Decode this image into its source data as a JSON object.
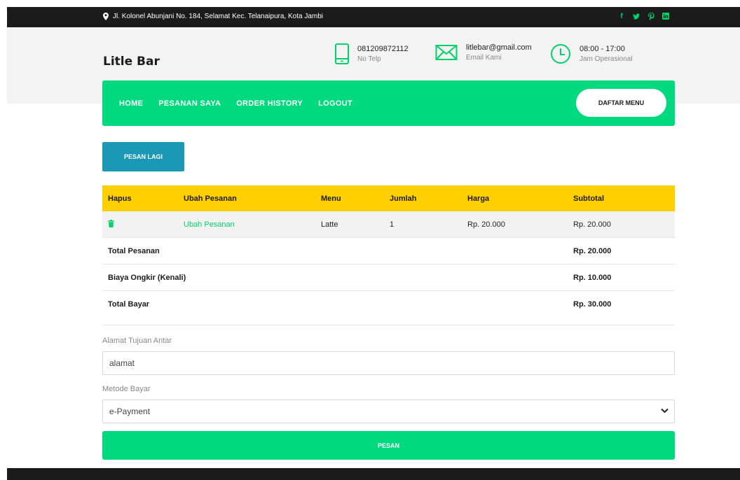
{
  "topbar": {
    "address": "Jl. Kolonel Abunjani No. 184, Selamat Kec. Telanaipura, Kota Jambi",
    "social": [
      "facebook-icon",
      "twitter-icon",
      "pinterest-icon",
      "linkedin-icon"
    ]
  },
  "header": {
    "brand": "Litle Bar",
    "phone": {
      "value": "081209872112",
      "label": "No Telp"
    },
    "email": {
      "value": "litlebar@gmail.com",
      "label": "Email Kami"
    },
    "hours": {
      "value": "08:00 - 17:00",
      "label": "Jam Operasional"
    }
  },
  "nav": {
    "items": [
      "HOME",
      "PESANAN SAYA",
      "ORDER HISTORY",
      "LOGOUT"
    ],
    "cta": "DAFTAR MENU"
  },
  "actions": {
    "pesan_lagi": "PESAN LAGI",
    "pesan": "PESAN"
  },
  "table": {
    "headers": [
      "Hapus",
      "Ubah Pesanan",
      "Menu",
      "Jumlah",
      "Harga",
      "Subtotal"
    ],
    "rows": [
      {
        "ubah": "Ubah Pesanan",
        "menu": "Latte",
        "jumlah": "1",
        "harga": "Rp. 20.000",
        "subtotal": "Rp. 20.000"
      }
    ],
    "summary": [
      {
        "label": "Total Pesanan",
        "value": "Rp. 20.000"
      },
      {
        "label": "Biaya Ongkir (Kenali)",
        "value": "Rp. 10.000"
      },
      {
        "label": "Total Bayar",
        "value": "Rp. 30.000"
      }
    ]
  },
  "form": {
    "address_label": "Alamat Tujuan Antar",
    "address_value": "alamat",
    "payment_label": "Metode Bayar",
    "payment_value": "e-Payment"
  },
  "colors": {
    "accent": "#00d97e",
    "header_yellow": "#ffcf00",
    "button_blue": "#1a98b6",
    "dark": "#1b1b1b"
  }
}
